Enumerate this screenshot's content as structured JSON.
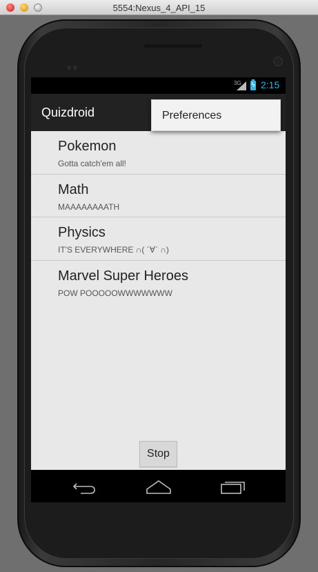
{
  "window": {
    "title": "5554:Nexus_4_API_15"
  },
  "status_bar": {
    "network": "3G",
    "time": "2:15",
    "accent": "#33b5e5"
  },
  "action_bar": {
    "title": "Quizdroid"
  },
  "overflow_menu": {
    "items": [
      {
        "label": "Preferences"
      }
    ]
  },
  "topics": [
    {
      "title": "Pokemon",
      "subtitle": "Gotta catch'em all!"
    },
    {
      "title": "Math",
      "subtitle": "MAAAAAAAATH"
    },
    {
      "title": "Physics",
      "subtitle": "IT'S EVERYWHERE ∩( ´∀` ∩)"
    },
    {
      "title": "Marvel Super Heroes",
      "subtitle": "POW POOOOOWWWWWWW"
    }
  ],
  "stop_button": {
    "label": "Stop"
  },
  "nav_bar": {
    "icons": [
      "back-icon",
      "home-icon",
      "recent-apps-icon"
    ]
  }
}
